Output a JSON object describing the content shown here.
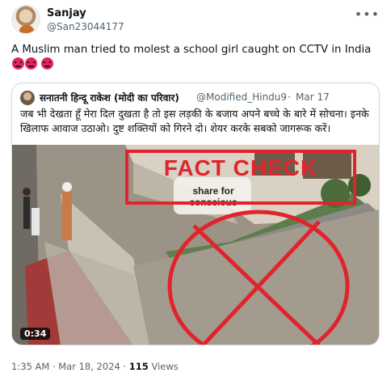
{
  "tweet": {
    "author_name": "Sanjay",
    "author_handle": "@San23044177",
    "text": "A Muslim man tried to molest a school girl caught on CCTV in India"
  },
  "quoted_tweet": {
    "author_name": "सनातनी हिन्दू राकेश (मोदी का परिवार)",
    "author_handle": "@Modified_Hindu9",
    "date": "Mar 17",
    "text": "जब भी देखता हूँ मेरा दिल दुखता है तो इस लड़की के बजाय अपने बच्चे के बारे में सोचना। इनके खिलाफ आवाज उठाओ। दुष्ट शक्तियों को गिरने दो। शेयर करके सबको जागरूक करें।"
  },
  "video": {
    "overlay_caption_line1": "share for",
    "overlay_caption_line2": "conscious",
    "stamp_text": "FACT CHECK",
    "duration": "0:34"
  },
  "meta": {
    "time": "1:35 AM",
    "separator": "·",
    "date": "Mar 18, 2024",
    "views_count": "115",
    "views_label": "Views"
  },
  "colors": {
    "stamp_red": "#e0242e",
    "text_primary": "#0f1419",
    "text_secondary": "#536471",
    "border": "#cfd9de"
  },
  "icons": {
    "more": "more-horizontal-icon",
    "angry_emoji": "angry-face-icon"
  }
}
